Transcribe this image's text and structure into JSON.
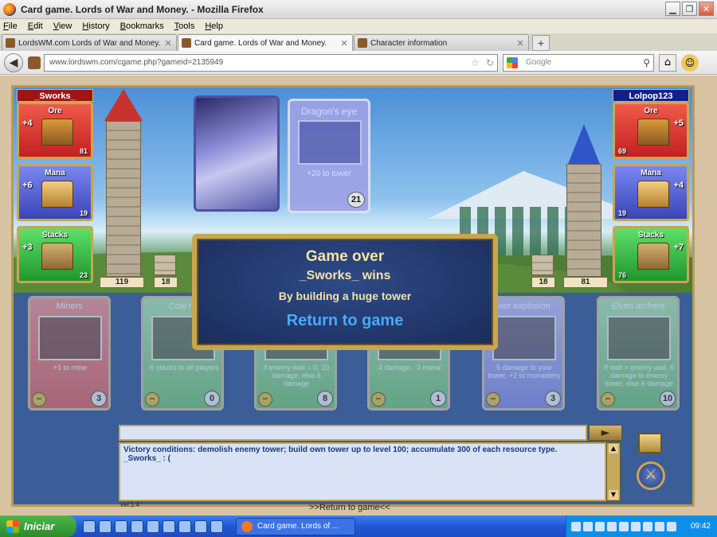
{
  "window": {
    "title": "Card game. Lords of War and Money. - Mozilla Firefox"
  },
  "menu": [
    "File",
    "Edit",
    "View",
    "History",
    "Bookmarks",
    "Tools",
    "Help"
  ],
  "tabs": [
    {
      "label": "LordsWM.com Lords of War and Money. ..."
    },
    {
      "label": "Card game. Lords of War and Money."
    },
    {
      "label": "Character information"
    }
  ],
  "nav": {
    "url": "www.lordswm.com/cgame.php?gameid=2135949",
    "search_placeholder": "Google"
  },
  "game": {
    "left_player": "_Sworks_",
    "right_player": "Lolpop123",
    "left_resources": [
      {
        "name": "Ore",
        "increment": "+4",
        "amount": "81"
      },
      {
        "name": "Mana",
        "increment": "+6",
        "amount": "19"
      },
      {
        "name": "Stacks",
        "increment": "+3",
        "amount": "23"
      }
    ],
    "right_resources": [
      {
        "name": "Ore",
        "increment": "+5",
        "amount": "69"
      },
      {
        "name": "Mana",
        "increment": "+4",
        "amount": "19"
      },
      {
        "name": "Stacks",
        "increment": "+7",
        "amount": "76"
      }
    ],
    "left_tower_height": "119",
    "left_wall_height": "18",
    "right_wall_height": "18",
    "right_tower_height": "81",
    "played_card": {
      "name": "Dragon's eye",
      "desc": "+20 to tower",
      "cost": "21"
    },
    "hand": [
      {
        "name": "Miners",
        "desc": "+1 to mine",
        "cost": "3",
        "color": "red"
      },
      {
        "name": "Cow ra",
        "desc": "-6 stacks to all players",
        "cost": "0",
        "color": "green"
      },
      {
        "name": "",
        "desc": "if enemy wall = 0, 10 damage, else 6 damage",
        "cost": "8",
        "color": "green"
      },
      {
        "name": "",
        "desc": "4 damage, -3 mana",
        "cost": "1",
        "color": "green"
      },
      {
        "name": "wer explosion",
        "desc": "5 damage to your tower, +2 to monastery",
        "cost": "3",
        "color": "blue"
      },
      {
        "name": "Elven archers",
        "desc": "If wall > enemy wall, 6 damage to enemy tower, else 6 damage",
        "cost": "10",
        "color": "green"
      }
    ],
    "modal": {
      "title": "Game over",
      "winner": "_Sworks_ wins",
      "reason": "By building a huge tower",
      "return": "Return to game"
    },
    "chat": [
      "Victory conditions: demolish enemy tower; build own tower up to level 100; accumulate 300 of each resource type.",
      "_Sworks_ : ("
    ],
    "version": "ver.1.4",
    "page_return_link": ">>Return to game<<"
  },
  "taskbar": {
    "start": "Iniciar",
    "task": "Card game. Lords of ...",
    "clock": "09:42"
  }
}
